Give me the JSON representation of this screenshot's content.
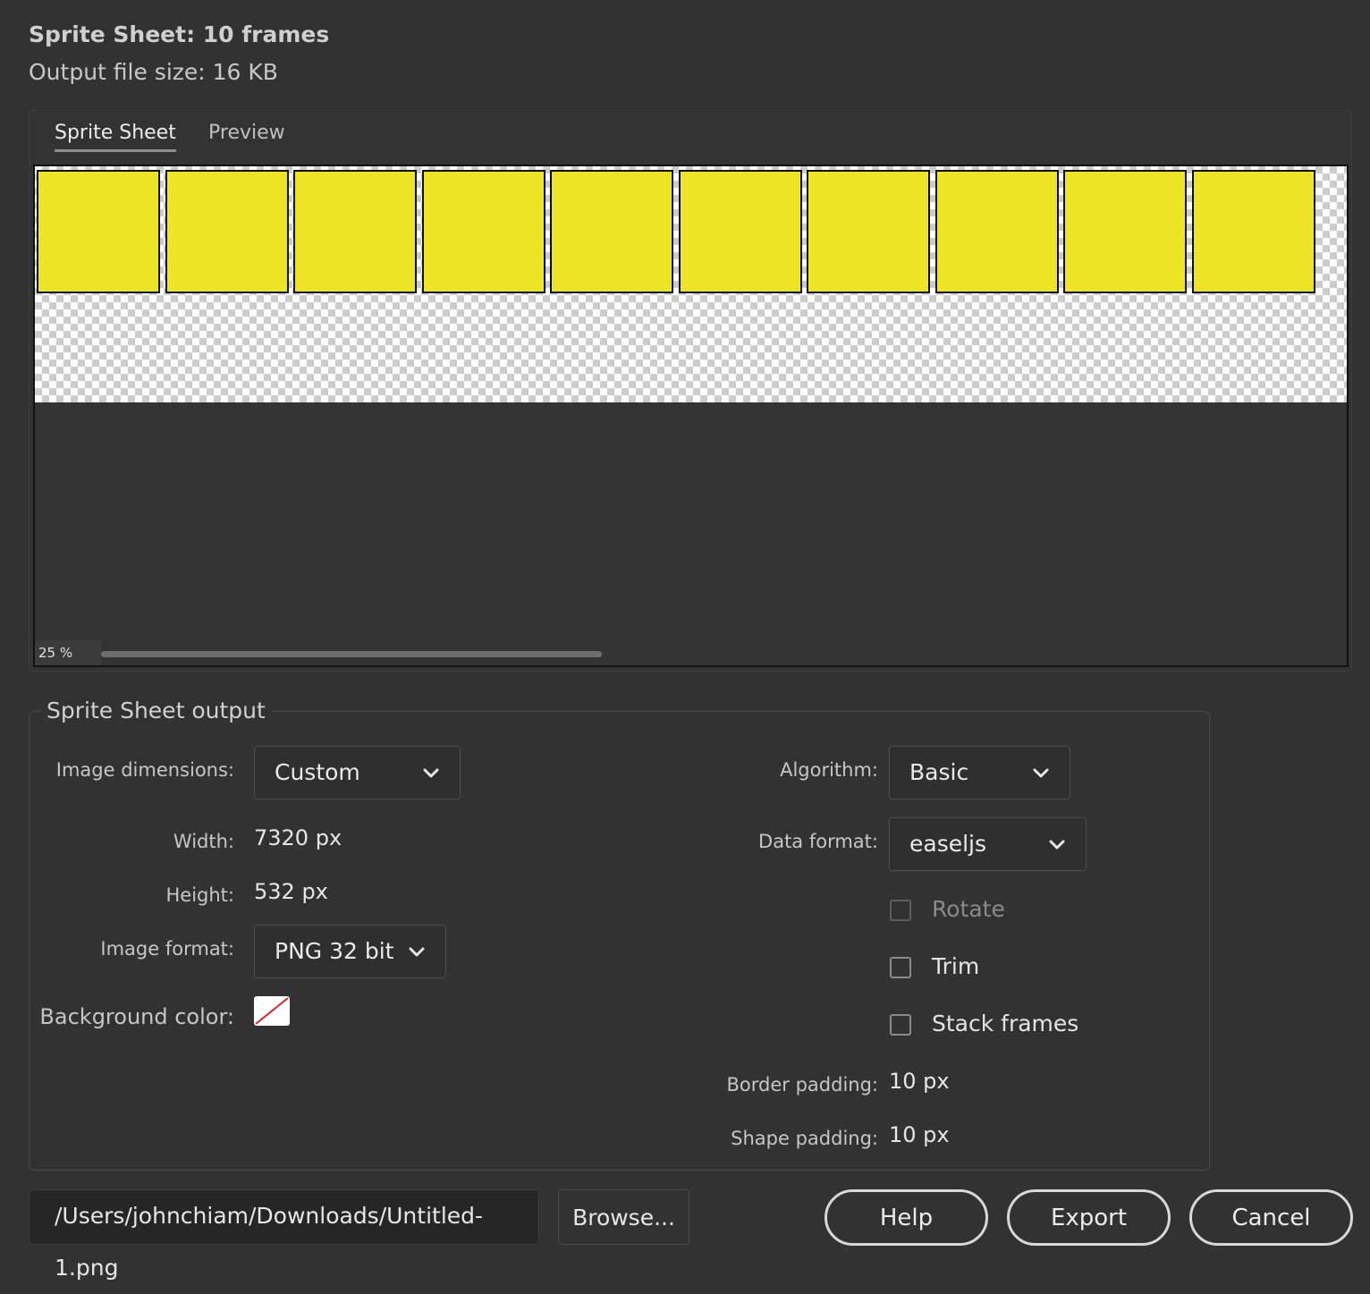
{
  "header": {
    "title": "Sprite Sheet: 10 frames",
    "file_size": "Output file size: 16 KB"
  },
  "tabs": [
    {
      "label": "Sprite Sheet",
      "active": true
    },
    {
      "label": "Preview",
      "active": false
    }
  ],
  "preview": {
    "frame_count": 10,
    "frame_color": "#ece424",
    "zoom": "25 %"
  },
  "output": {
    "legend": "Sprite Sheet output",
    "image_dimensions": {
      "label": "Image dimensions:",
      "value": "Custom"
    },
    "width": {
      "label": "Width:",
      "value": "7320 px"
    },
    "height": {
      "label": "Height:",
      "value": "532 px"
    },
    "image_format": {
      "label": "Image format:",
      "value": "PNG 32 bit"
    },
    "background_color": {
      "label": "Background color:",
      "value": "none"
    },
    "algorithm": {
      "label": "Algorithm:",
      "value": "Basic"
    },
    "data_format": {
      "label": "Data format:",
      "value": "easeljs"
    },
    "rotate": {
      "label": "Rotate",
      "checked": false,
      "enabled": false
    },
    "trim": {
      "label": "Trim",
      "checked": false,
      "enabled": true
    },
    "stack_frames": {
      "label": "Stack frames",
      "checked": false,
      "enabled": true
    },
    "border_padding": {
      "label": "Border padding:",
      "value": "10 px"
    },
    "shape_padding": {
      "label": "Shape padding:",
      "value": "10 px"
    }
  },
  "footer": {
    "path": "/Users/johnchiam/Downloads/Untitled-1.png",
    "browse_label": "Browse...",
    "help_label": "Help",
    "export_label": "Export",
    "cancel_label": "Cancel"
  }
}
